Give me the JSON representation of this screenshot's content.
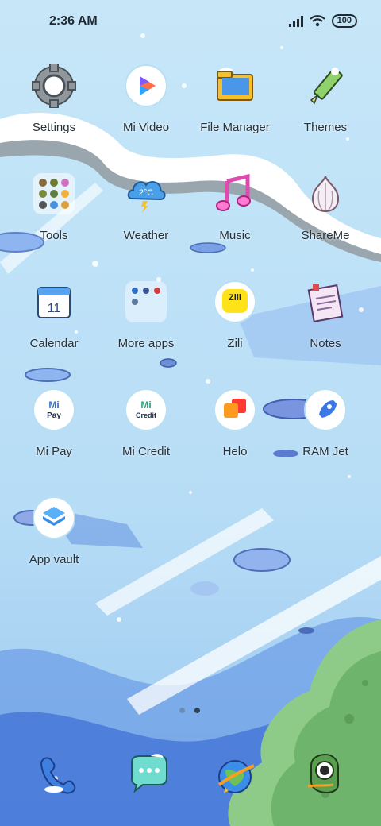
{
  "status_bar": {
    "time": "2:36 AM",
    "battery": "100"
  },
  "apps": [
    {
      "id": "settings",
      "label": "Settings",
      "icon": "gear-icon"
    },
    {
      "id": "mi-video",
      "label": "Mi Video",
      "icon": "play-icon"
    },
    {
      "id": "file-manager",
      "label": "File Manager",
      "icon": "folder-icon"
    },
    {
      "id": "themes",
      "label": "Themes",
      "icon": "pencil-icon"
    },
    {
      "id": "tools",
      "label": "Tools",
      "icon": "tools-folder-icon"
    },
    {
      "id": "weather",
      "label": "Weather",
      "icon": "cloud-icon",
      "text": "2°C"
    },
    {
      "id": "music",
      "label": "Music",
      "icon": "music-note-icon"
    },
    {
      "id": "shareme",
      "label": "ShareMe",
      "icon": "garlic-icon"
    },
    {
      "id": "calendar",
      "label": "Calendar",
      "icon": "calendar-icon",
      "text": "11"
    },
    {
      "id": "more-apps",
      "label": "More apps",
      "icon": "apps-folder-icon"
    },
    {
      "id": "zili",
      "label": "Zili",
      "icon": "zili-icon",
      "text": "Zili"
    },
    {
      "id": "notes",
      "label": "Notes",
      "icon": "notes-icon"
    },
    {
      "id": "mi-pay",
      "label": "Mi Pay",
      "icon": "mi-pay-icon",
      "text": "Pay"
    },
    {
      "id": "mi-credit",
      "label": "Mi Credit",
      "icon": "mi-credit-icon",
      "text": "Credit"
    },
    {
      "id": "helo",
      "label": "Helo",
      "icon": "chat-bubble-icon"
    },
    {
      "id": "ram-jet",
      "label": "RAM Jet",
      "icon": "rocket-icon"
    },
    {
      "id": "app-vault",
      "label": "App vault",
      "icon": "stack-icon"
    }
  ],
  "page_indicator": {
    "pages": 2,
    "active": 2
  },
  "dock": [
    {
      "id": "phone",
      "icon": "phone-icon"
    },
    {
      "id": "messages",
      "icon": "message-icon"
    },
    {
      "id": "browser",
      "icon": "globe-icon"
    },
    {
      "id": "camera",
      "icon": "camera-icon"
    }
  ],
  "colors": {
    "sky": "#bfe3f7",
    "deep_blue": "#4b7fdd",
    "snow": "#ffffff",
    "bush_green": "#7fbf7a"
  }
}
